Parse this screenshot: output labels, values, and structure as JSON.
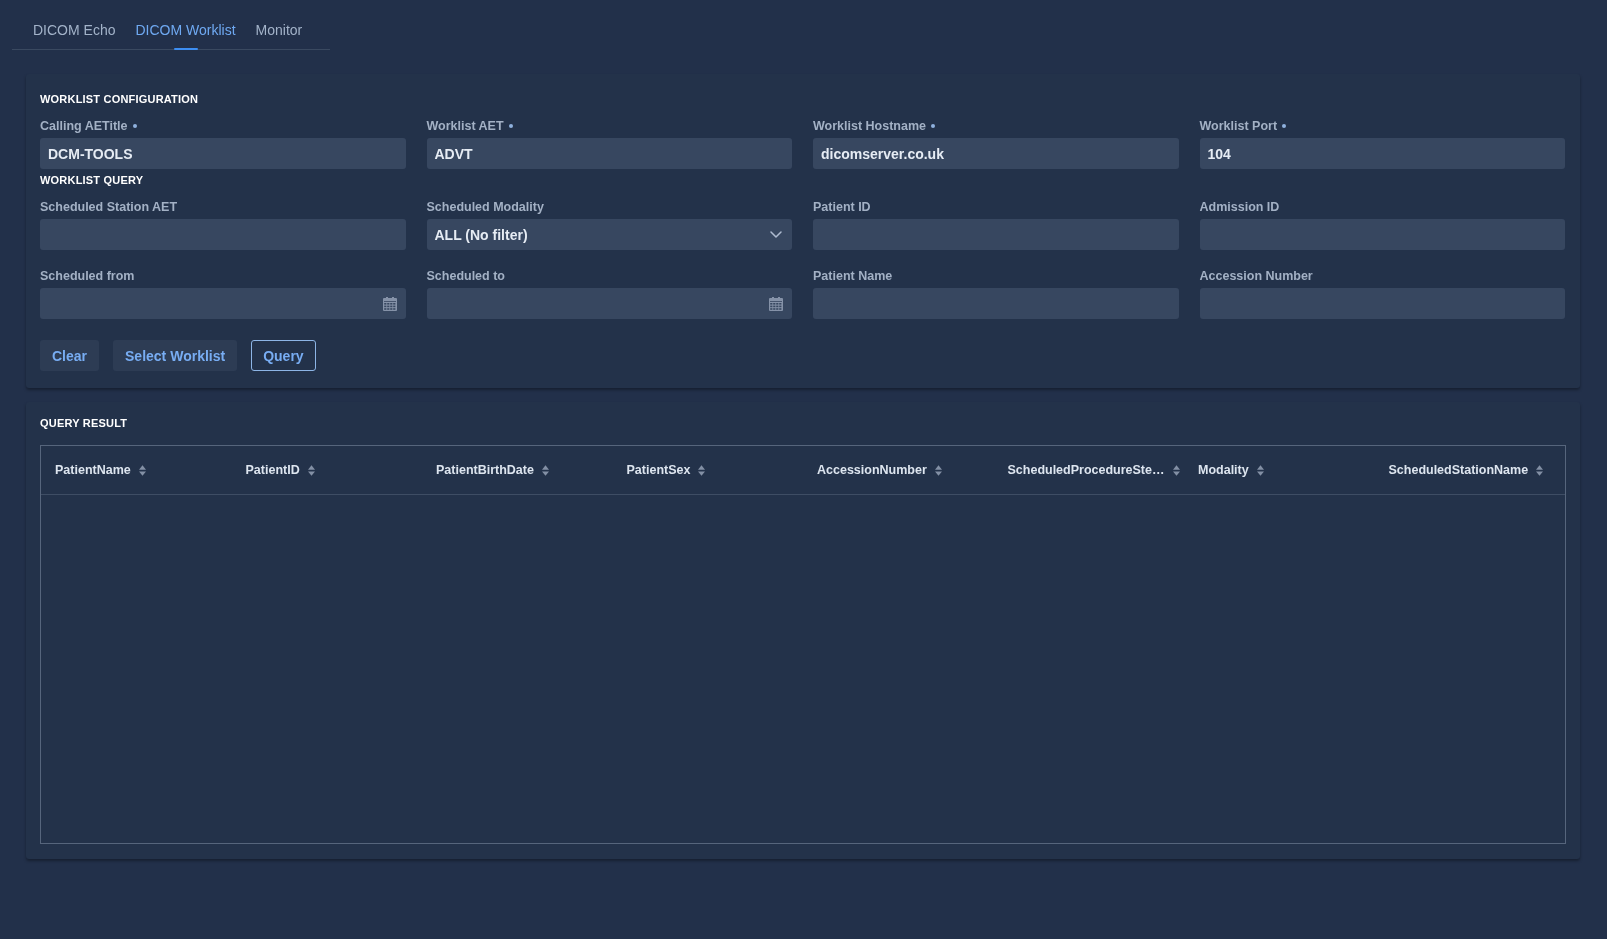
{
  "tabs": [
    {
      "label": "DICOM Echo",
      "selected": false
    },
    {
      "label": "DICOM Worklist",
      "selected": true
    },
    {
      "label": "Monitor",
      "selected": false
    }
  ],
  "configuration": {
    "title": "WORKLIST CONFIGURATION",
    "fields": [
      {
        "label": "Calling AETitle",
        "required": true,
        "kind": "text",
        "value": "DCM-TOOLS"
      },
      {
        "label": "Worklist AET",
        "required": true,
        "kind": "text",
        "value": "ADVT"
      },
      {
        "label": "Worklist Hostname",
        "required": true,
        "kind": "text",
        "value": "dicomserver.co.uk"
      },
      {
        "label": "Worklist Port",
        "required": true,
        "kind": "text",
        "value": "104"
      }
    ]
  },
  "query": {
    "title": "WORKLIST QUERY",
    "fields": [
      {
        "label": "Scheduled Station AET",
        "kind": "text"
      },
      {
        "label": "Scheduled Modality",
        "kind": "select",
        "value": "ALL (No filter)"
      },
      {
        "label": "Patient ID",
        "kind": "text"
      },
      {
        "label": "Admission ID",
        "kind": "text"
      },
      {
        "label": "Scheduled from",
        "kind": "date"
      },
      {
        "label": "Scheduled to",
        "kind": "date"
      },
      {
        "label": "Patient Name",
        "kind": "text"
      },
      {
        "label": "Accession Number",
        "kind": "text"
      }
    ]
  },
  "buttons": [
    {
      "label": "Clear",
      "kind": "filled"
    },
    {
      "label": "Select Worklist",
      "kind": "filled"
    },
    {
      "label": "Query",
      "kind": "outlined"
    }
  ],
  "result": {
    "title": "QUERY RESULT",
    "columns": [
      "PatientName",
      "PatientID",
      "PatientBirthDate",
      "PatientSex",
      "AccessionNumber",
      "ScheduledProcedureSte…",
      "Modality",
      "ScheduledStationName"
    ]
  }
}
